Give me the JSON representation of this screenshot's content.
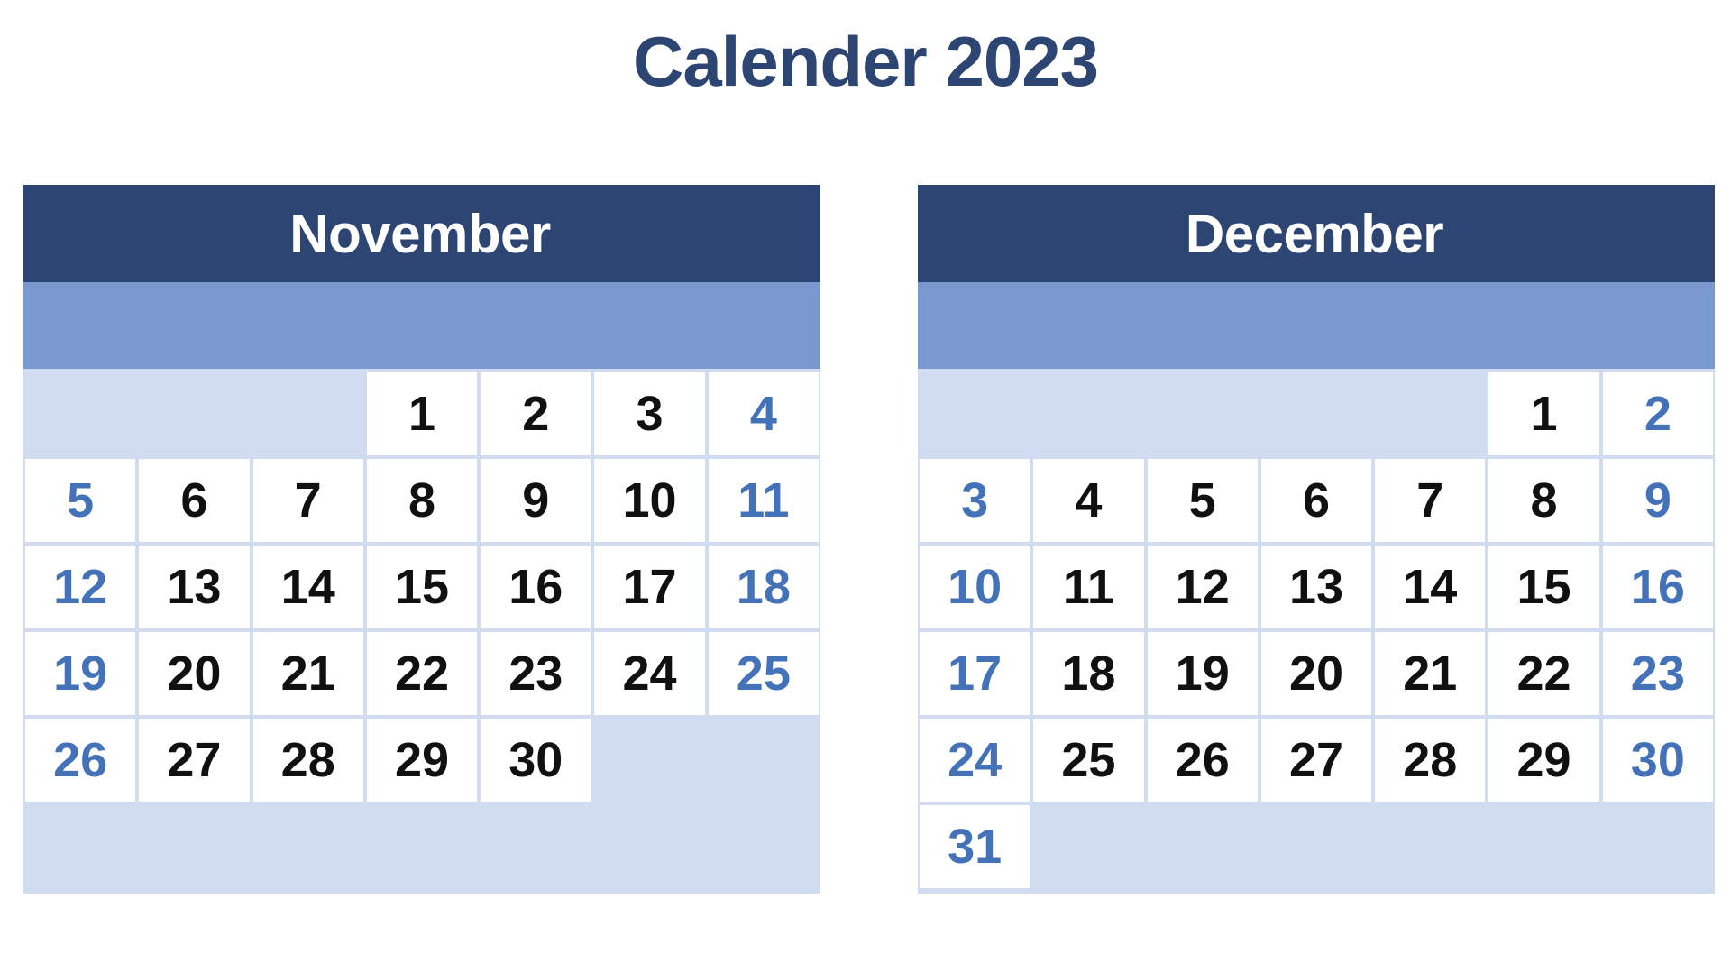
{
  "title": "Calender 2023",
  "colors": {
    "title_text": "#2d4573",
    "month_header_bg": "#2d4573",
    "month_header_text": "#ffffff",
    "weekday_band_bg": "#7a99d0",
    "filler_cell_bg": "#d2dcf0",
    "day_cell_bg": "#ffffff",
    "weekday_number": "#101010",
    "weekend_number": "#4472b8"
  },
  "weekday_labels": [
    "",
    "",
    "",
    "",
    "",
    "",
    ""
  ],
  "months": [
    {
      "name": "November",
      "year": "2023",
      "first_day_column": 4,
      "days_in_month": 30,
      "weeks": [
        [
          {
            "label": "",
            "type": "filler"
          },
          {
            "label": "",
            "type": "filler"
          },
          {
            "label": "",
            "type": "filler"
          },
          {
            "label": "1",
            "type": "weekday"
          },
          {
            "label": "2",
            "type": "weekday"
          },
          {
            "label": "3",
            "type": "weekday"
          },
          {
            "label": "4",
            "type": "weekend"
          }
        ],
        [
          {
            "label": "5",
            "type": "weekend"
          },
          {
            "label": "6",
            "type": "weekday"
          },
          {
            "label": "7",
            "type": "weekday"
          },
          {
            "label": "8",
            "type": "weekday"
          },
          {
            "label": "9",
            "type": "weekday"
          },
          {
            "label": "10",
            "type": "weekday"
          },
          {
            "label": "11",
            "type": "weekend"
          }
        ],
        [
          {
            "label": "12",
            "type": "weekend"
          },
          {
            "label": "13",
            "type": "weekday"
          },
          {
            "label": "14",
            "type": "weekday"
          },
          {
            "label": "15",
            "type": "weekday"
          },
          {
            "label": "16",
            "type": "weekday"
          },
          {
            "label": "17",
            "type": "weekday"
          },
          {
            "label": "18",
            "type": "weekend"
          }
        ],
        [
          {
            "label": "19",
            "type": "weekend"
          },
          {
            "label": "20",
            "type": "weekday"
          },
          {
            "label": "21",
            "type": "weekday"
          },
          {
            "label": "22",
            "type": "weekday"
          },
          {
            "label": "23",
            "type": "weekday"
          },
          {
            "label": "24",
            "type": "weekday"
          },
          {
            "label": "25",
            "type": "weekend"
          }
        ],
        [
          {
            "label": "26",
            "type": "weekend"
          },
          {
            "label": "27",
            "type": "weekday"
          },
          {
            "label": "28",
            "type": "weekday"
          },
          {
            "label": "29",
            "type": "weekday"
          },
          {
            "label": "30",
            "type": "weekday"
          },
          {
            "label": "",
            "type": "filler"
          },
          {
            "label": "",
            "type": "filler"
          }
        ],
        [
          {
            "label": "",
            "type": "filler"
          },
          {
            "label": "",
            "type": "filler"
          },
          {
            "label": "",
            "type": "filler"
          },
          {
            "label": "",
            "type": "filler"
          },
          {
            "label": "",
            "type": "filler"
          },
          {
            "label": "",
            "type": "filler"
          },
          {
            "label": "",
            "type": "filler"
          }
        ]
      ]
    },
    {
      "name": "December",
      "year": "2023",
      "first_day_column": 6,
      "days_in_month": 31,
      "weeks": [
        [
          {
            "label": "",
            "type": "filler"
          },
          {
            "label": "",
            "type": "filler"
          },
          {
            "label": "",
            "type": "filler"
          },
          {
            "label": "",
            "type": "filler"
          },
          {
            "label": "",
            "type": "filler"
          },
          {
            "label": "1",
            "type": "weekday"
          },
          {
            "label": "2",
            "type": "weekend"
          }
        ],
        [
          {
            "label": "3",
            "type": "weekend"
          },
          {
            "label": "4",
            "type": "weekday"
          },
          {
            "label": "5",
            "type": "weekday"
          },
          {
            "label": "6",
            "type": "weekday"
          },
          {
            "label": "7",
            "type": "weekday"
          },
          {
            "label": "8",
            "type": "weekday"
          },
          {
            "label": "9",
            "type": "weekend"
          }
        ],
        [
          {
            "label": "10",
            "type": "weekend"
          },
          {
            "label": "11",
            "type": "weekday"
          },
          {
            "label": "12",
            "type": "weekday"
          },
          {
            "label": "13",
            "type": "weekday"
          },
          {
            "label": "14",
            "type": "weekday"
          },
          {
            "label": "15",
            "type": "weekday"
          },
          {
            "label": "16",
            "type": "weekend"
          }
        ],
        [
          {
            "label": "17",
            "type": "weekend"
          },
          {
            "label": "18",
            "type": "weekday"
          },
          {
            "label": "19",
            "type": "weekday"
          },
          {
            "label": "20",
            "type": "weekday"
          },
          {
            "label": "21",
            "type": "weekday"
          },
          {
            "label": "22",
            "type": "weekday"
          },
          {
            "label": "23",
            "type": "weekend"
          }
        ],
        [
          {
            "label": "24",
            "type": "weekend"
          },
          {
            "label": "25",
            "type": "weekday"
          },
          {
            "label": "26",
            "type": "weekday"
          },
          {
            "label": "27",
            "type": "weekday"
          },
          {
            "label": "28",
            "type": "weekday"
          },
          {
            "label": "29",
            "type": "weekday"
          },
          {
            "label": "30",
            "type": "weekend"
          }
        ],
        [
          {
            "label": "31",
            "type": "weekend"
          },
          {
            "label": "",
            "type": "filler"
          },
          {
            "label": "",
            "type": "filler"
          },
          {
            "label": "",
            "type": "filler"
          },
          {
            "label": "",
            "type": "filler"
          },
          {
            "label": "",
            "type": "filler"
          },
          {
            "label": "",
            "type": "filler"
          }
        ]
      ]
    }
  ]
}
